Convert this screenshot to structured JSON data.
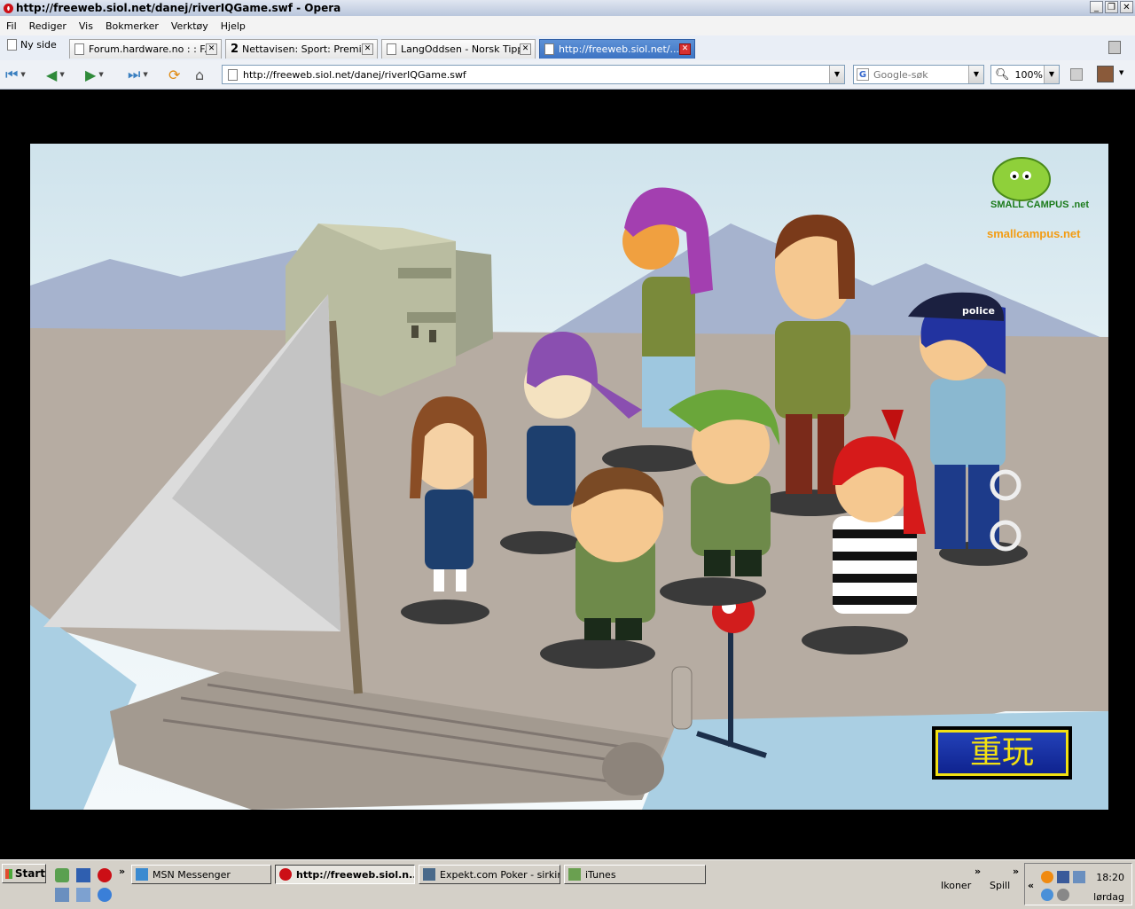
{
  "window": {
    "title": "http://freeweb.siol.net/danej/riverIQGame.swf - Opera",
    "controls": [
      "_",
      "❐",
      "✕"
    ]
  },
  "menu": [
    "Fil",
    "Rediger",
    "Vis",
    "Bokmerker",
    "Verktøy",
    "Hjelp"
  ],
  "tabs": {
    "new_page_label": "Ny side",
    "items": [
      {
        "label": "Forum.hardware.no : : F...",
        "active": false
      },
      {
        "label": "Nettavisen: Sport: Premi...",
        "active": false,
        "prefix": "2"
      },
      {
        "label": "LangOddsen - Norsk Tipp...",
        "active": false
      },
      {
        "label": "http://freeweb.siol.net/...",
        "active": true
      }
    ]
  },
  "nav": {
    "address": "http://freeweb.siol.net/danej/riverIQGame.swf",
    "search_placeholder": "Google-søk",
    "zoom": "100%"
  },
  "game": {
    "logo_text": "smallcampus.net",
    "logo_badge": "SMALL CAMPUS .net",
    "police_cap_text": "police",
    "replay_label": "重玩",
    "colors": {
      "sky": "#e7f2f6",
      "mountain": "#a6b3ce",
      "ground": "#b6aca2",
      "water": "#aacfe3",
      "button_blue": "#1a33a8",
      "button_yellow": "#f2e012"
    }
  },
  "taskbar": {
    "start_label": "Start",
    "tasks": [
      {
        "label": "MSN Messenger",
        "active": false
      },
      {
        "label": "http://freeweb.siol.n...",
        "active": true
      },
      {
        "label": "Expekt.com Poker - sirkim",
        "active": false
      },
      {
        "label": "iTunes",
        "active": false
      }
    ],
    "toolbar_labels": [
      "Ikoner",
      "Spill"
    ],
    "overflow_glyph": "»",
    "tray_expand": "«",
    "time": "18:20",
    "day": "lørdag"
  }
}
